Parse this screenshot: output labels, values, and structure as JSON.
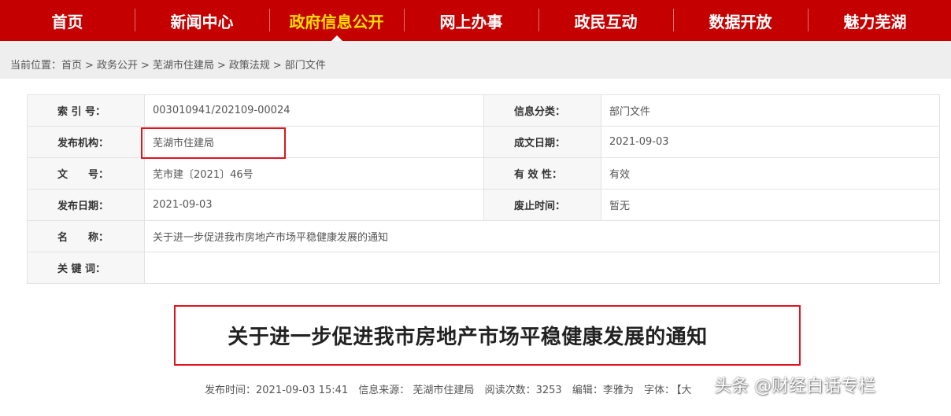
{
  "nav": {
    "items": [
      {
        "label": "首页"
      },
      {
        "label": "新闻中心"
      },
      {
        "label": "政府信息公开"
      },
      {
        "label": "网上办事"
      },
      {
        "label": "政民互动"
      },
      {
        "label": "数据开放"
      },
      {
        "label": "魅力芜湖"
      }
    ],
    "active_label": "政府信息公开"
  },
  "breadcrumb": {
    "prefix": "当前位置：",
    "items": [
      "首页",
      "政务公开",
      "芜湖市住建局",
      "政策法规",
      "部门文件"
    ],
    "separator": ">"
  },
  "info": {
    "index_no_label": "索 引 号：",
    "index_no": "003010941/202109-00024",
    "category_label": "信息分类：",
    "category": "部门文件",
    "publisher_label": "发布机构：",
    "publisher": "芜湖市住建局",
    "created_label": "成文日期：",
    "created": "2021-09-03",
    "doc_no_label": "文　　号：",
    "doc_no": "芜市建〔2021〕46号",
    "validity_label": "有 效 性：",
    "validity": "有效",
    "published_label": "发布日期：",
    "published": "2021-09-03",
    "abolished_label": "废止时间：",
    "abolished": "暂无",
    "name_label": "名　　称：",
    "name": "关于进一步促进我市房地产市场平稳健康发展的通知",
    "keywords_label": "关 键 词：",
    "keywords": ""
  },
  "article": {
    "title": "关于进一步促进我市房地产市场平稳健康发展的通知",
    "publish_time": "发布时间：2021-09-03 15:41",
    "source": "信息来源：  芜湖市住建局",
    "reads": "阅读次数：3253",
    "editor": "编辑：李雅为",
    "font_label": "字体：",
    "font_option": "【大"
  },
  "watermark": "头条 @财经白话专栏",
  "colors": {
    "nav_bg": "#c40000",
    "nav_active": "#ffe000",
    "highlight_border": "#e0141e"
  }
}
